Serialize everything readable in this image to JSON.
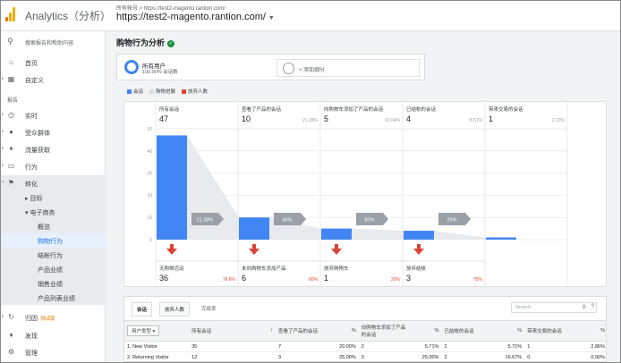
{
  "header": {
    "app_title": "Analytics（分析）",
    "breadcrumb": "所有帐号 > https://test2-magento.rantion.com/",
    "site": "https://test2-magento.rantion.com/",
    "icon": "analytics-logo"
  },
  "sidebar": {
    "search_placeholder": "搜索报告和帮助内容",
    "items": [
      {
        "label": "首页",
        "icon": "home-icon"
      },
      {
        "label": "自定义",
        "icon": "dashboard-icon"
      }
    ],
    "section_label": "报告",
    "reports": [
      {
        "label": "实时",
        "icon": "clock-icon"
      },
      {
        "label": "受众群体",
        "icon": "person-icon"
      },
      {
        "label": "流量获取",
        "icon": "acquisition-icon"
      },
      {
        "label": "行为",
        "icon": "behavior-icon"
      },
      {
        "label": "转化",
        "icon": "flag-icon"
      }
    ],
    "conversions_sub": [
      "目标",
      "电子商务"
    ],
    "ecommerce_items": [
      "概览",
      "购物行为",
      "结帐行为",
      "产品业绩",
      "销售业绩",
      "产品列表业绩"
    ],
    "bottom": [
      {
        "label": "归因",
        "badge": "测试版",
        "icon": "attribution-icon"
      },
      {
        "label": "发现",
        "icon": "bulb-icon"
      },
      {
        "label": "管理",
        "icon": "gear-icon"
      }
    ]
  },
  "main": {
    "title": "购物行为分析",
    "segments": {
      "primary_name": "所有用户",
      "primary_sub": "100.00% 会话数",
      "add_label": "+ 添加细分"
    },
    "legend": [
      {
        "label": "会话",
        "color": "#4285f4"
      },
      {
        "label": "购物进展",
        "color": "#dadce0"
      },
      {
        "label": "放弃人数",
        "color": "#db4437"
      }
    ]
  },
  "chart_data": {
    "type": "bar",
    "y_ticks": [
      0,
      10,
      20,
      30,
      40,
      50
    ],
    "ylim": [
      0,
      50
    ],
    "stages": [
      {
        "label": "所有会话",
        "value": 47,
        "pct": ""
      },
      {
        "label": "查看了产品的会话",
        "value": 10,
        "pct": "21.28%"
      },
      {
        "label": "向购物车添加了产品的会话",
        "value": 5,
        "pct": "10.64%"
      },
      {
        "label": "已结帐的会话",
        "value": 4,
        "pct": "8.51%"
      },
      {
        "label": "带来交易的会话",
        "value": 1,
        "pct": "2.13%"
      }
    ],
    "conversion_rates": [
      "21.28%",
      "40%",
      "80%",
      "25%"
    ],
    "abandonment": [
      {
        "label": "无购物活动",
        "value": 36,
        "pct": "76.6%"
      },
      {
        "label": "未向购物车添加产品",
        "value": 6,
        "pct": "60%"
      },
      {
        "label": "放弃购物车",
        "value": 1,
        "pct": "20%"
      },
      {
        "label": "放弃结帐",
        "value": 3,
        "pct": "75%"
      }
    ],
    "bar_color": "#4285f4",
    "abandon_color": "#db4437"
  },
  "table": {
    "tabs": [
      "会话",
      "放弃人数",
      "完成率"
    ],
    "search_placeholder": "Search",
    "dimension": "用户类型",
    "headers": [
      "所有会话",
      "查看了产品的会话",
      "%",
      "向购物车添加了产品的会话",
      "%",
      "已结帐的会话",
      "%",
      "带来交易的会话",
      "%"
    ],
    "rows": [
      {
        "idx": "1.",
        "name": "New Visitor",
        "cells": [
          "35",
          "7",
          "20.00%",
          "2",
          "5.71%",
          "2",
          "5.71%",
          "1",
          "2.86%"
        ]
      },
      {
        "idx": "2.",
        "name": "Returning Visitor",
        "cells": [
          "12",
          "3",
          "25.00%",
          "3",
          "25.00%",
          "2",
          "16.67%",
          "0",
          "0.00%"
        ]
      }
    ]
  }
}
